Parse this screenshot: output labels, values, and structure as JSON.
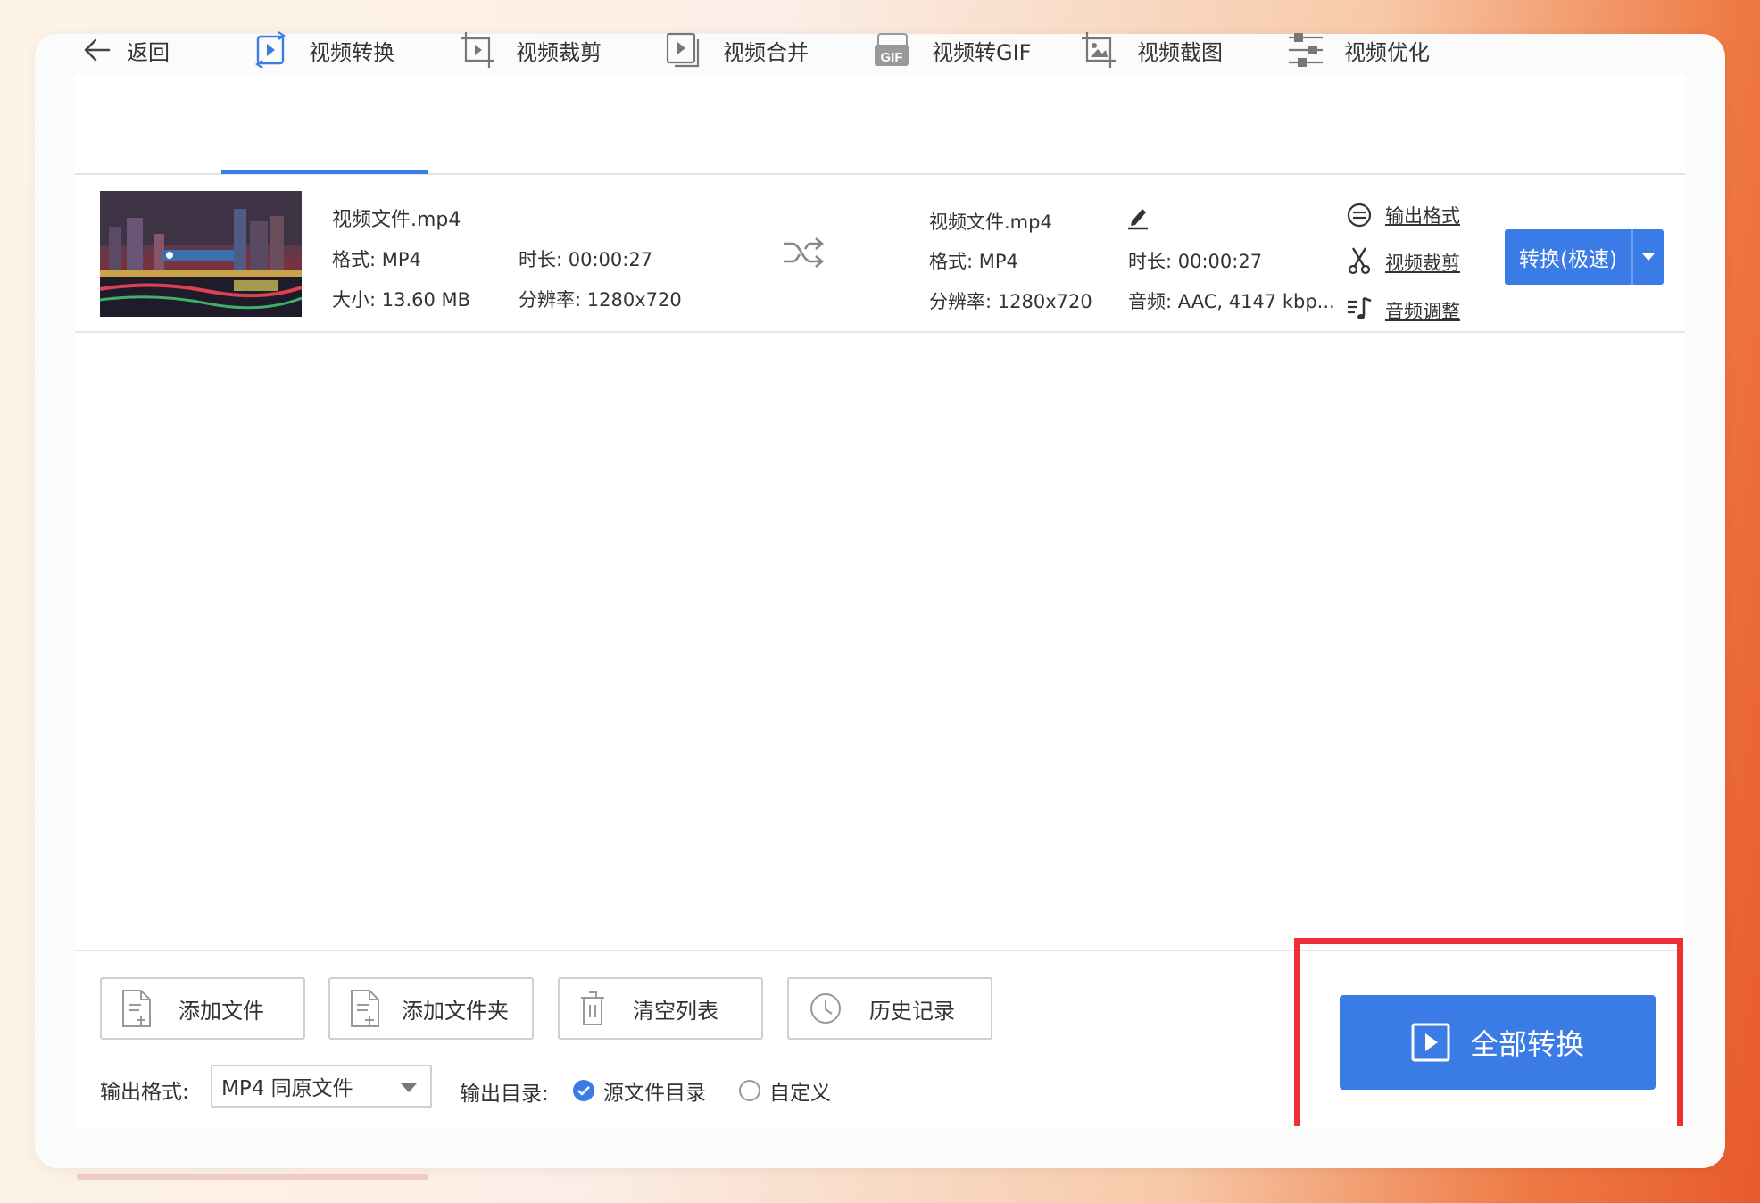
{
  "nav": {
    "back": "返回",
    "tabs": [
      {
        "label": "视频转换",
        "icon": "video-convert-icon"
      },
      {
        "label": "视频裁剪",
        "icon": "crop-icon"
      },
      {
        "label": "视频合并",
        "icon": "merge-icon"
      },
      {
        "label": "视频转GIF",
        "icon": "gif-icon"
      },
      {
        "label": "视频截图",
        "icon": "screenshot-icon"
      },
      {
        "label": "视频优化",
        "icon": "sliders-icon"
      }
    ],
    "active_tab": "视频转换"
  },
  "file": {
    "source": {
      "name": "视频文件.mp4",
      "format": "格式: MP4",
      "size": "大小: 13.60 MB",
      "duration": "时长: 00:00:27",
      "resolution": "分辨率: 1280x720"
    },
    "output": {
      "name": "视频文件.mp4",
      "format": "格式: MP4",
      "resolution": "分辨率: 1280x720",
      "duration": "时长: 00:00:27",
      "audio": "音频: AAC, 4147 kbp..."
    },
    "actions": {
      "output_format": "输出格式",
      "video_crop": "视频裁剪",
      "audio_adjust": "音频调整"
    },
    "convert_button": "转换(极速)"
  },
  "bottom": {
    "add_file": "添加文件",
    "add_folder": "添加文件夹",
    "clear_list": "清空列表",
    "history": "历史记录",
    "output_format_label": "输出格式:",
    "output_format_value": "MP4 同原文件",
    "output_dir_label": "输出目录:",
    "dir_source": "源文件目录",
    "dir_custom": "自定义",
    "dir_selected": "源文件目录",
    "convert_all": "全部转换"
  },
  "colors": {
    "accent": "#3a7be6",
    "highlight": "#ee3036"
  }
}
